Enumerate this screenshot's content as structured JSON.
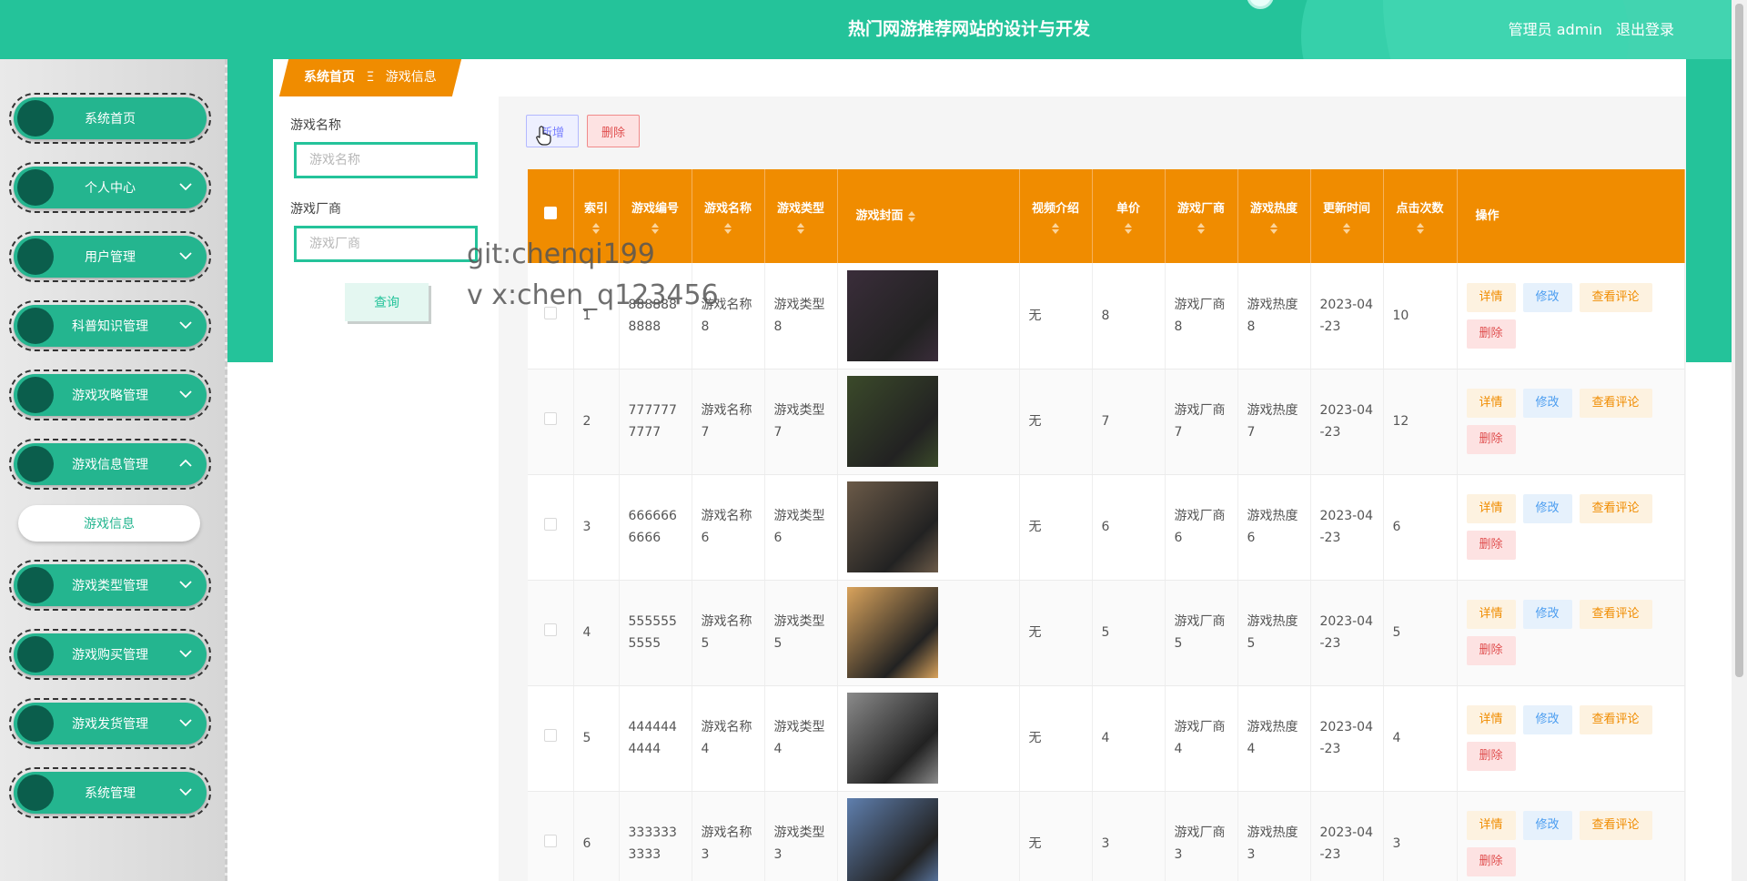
{
  "header": {
    "title": "热门网游推荐网站的设计与开发",
    "user_label": "管理员 admin",
    "logout_label": "退出登录"
  },
  "sidebar": {
    "items": [
      {
        "label": "系统首页",
        "expandable": false
      },
      {
        "label": "个人中心",
        "expandable": true
      },
      {
        "label": "用户管理",
        "expandable": true
      },
      {
        "label": "科普知识管理",
        "expandable": true
      },
      {
        "label": "游戏攻略管理",
        "expandable": true
      },
      {
        "label": "游戏信息管理",
        "expandable": true,
        "expanded": true
      },
      {
        "label": "游戏类型管理",
        "expandable": true
      },
      {
        "label": "游戏购买管理",
        "expandable": true
      },
      {
        "label": "游戏发货管理",
        "expandable": true
      },
      {
        "label": "系统管理",
        "expandable": true
      }
    ],
    "submenu": {
      "label": "游戏信息"
    }
  },
  "breadcrumb": {
    "home": "系统首页",
    "separator": "Ξ",
    "current": "游戏信息"
  },
  "search": {
    "name_label": "游戏名称",
    "name_placeholder": "游戏名称",
    "vendor_label": "游戏厂商",
    "vendor_placeholder": "游戏厂商",
    "query_button": "查询"
  },
  "toolbar": {
    "add_label": "新增",
    "delete_label": "删除"
  },
  "table": {
    "headers": {
      "index": "索引",
      "code": "游戏编号",
      "name": "游戏名称",
      "type": "游戏类型",
      "cover": "游戏封面",
      "video": "视频介绍",
      "price": "单价",
      "vendor": "游戏厂商",
      "heat": "游戏热度",
      "updated": "更新时间",
      "clicks": "点击次数",
      "actions": "操作"
    },
    "actions": {
      "detail": "详情",
      "edit": "修改",
      "review": "查看评论",
      "delete": "删除"
    },
    "rows": [
      {
        "index": "1",
        "code": "8888888888",
        "name": "游戏名称8",
        "type": "游戏类型8",
        "video": "无",
        "price": "8",
        "vendor": "游戏厂商8",
        "heat": "游戏热度8",
        "updated": "2023-04-23",
        "clicks": "10",
        "cover_color": "#3a2d3a"
      },
      {
        "index": "2",
        "code": "7777777777",
        "name": "游戏名称7",
        "type": "游戏类型7",
        "video": "无",
        "price": "7",
        "vendor": "游戏厂商7",
        "heat": "游戏热度7",
        "updated": "2023-04-23",
        "clicks": "12",
        "cover_color": "#3b4a2a"
      },
      {
        "index": "3",
        "code": "6666666666",
        "name": "游戏名称6",
        "type": "游戏类型6",
        "video": "无",
        "price": "6",
        "vendor": "游戏厂商6",
        "heat": "游戏热度6",
        "updated": "2023-04-23",
        "clicks": "6",
        "cover_color": "#6b5a48"
      },
      {
        "index": "4",
        "code": "5555555555",
        "name": "游戏名称5",
        "type": "游戏类型5",
        "video": "无",
        "price": "5",
        "vendor": "游戏厂商5",
        "heat": "游戏热度5",
        "updated": "2023-04-23",
        "clicks": "5",
        "cover_color": "#d9a35c"
      },
      {
        "index": "5",
        "code": "4444444444",
        "name": "游戏名称4",
        "type": "游戏类型4",
        "video": "无",
        "price": "4",
        "vendor": "游戏厂商4",
        "heat": "游戏热度4",
        "updated": "2023-04-23",
        "clicks": "4",
        "cover_color": "#8a8a8a"
      },
      {
        "index": "6",
        "code": "3333333333",
        "name": "游戏名称3",
        "type": "游戏类型3",
        "video": "无",
        "price": "3",
        "vendor": "游戏厂商3",
        "heat": "游戏热度3",
        "updated": "2023-04-23",
        "clicks": "3",
        "cover_color": "#5f7fae"
      }
    ]
  },
  "watermark": {
    "line1": "git:chenqi199",
    "line2": "v x:chen_q123456"
  },
  "colors": {
    "primary": "#24c39a",
    "header_orange": "#f08c00",
    "danger": "#e04f4f"
  }
}
